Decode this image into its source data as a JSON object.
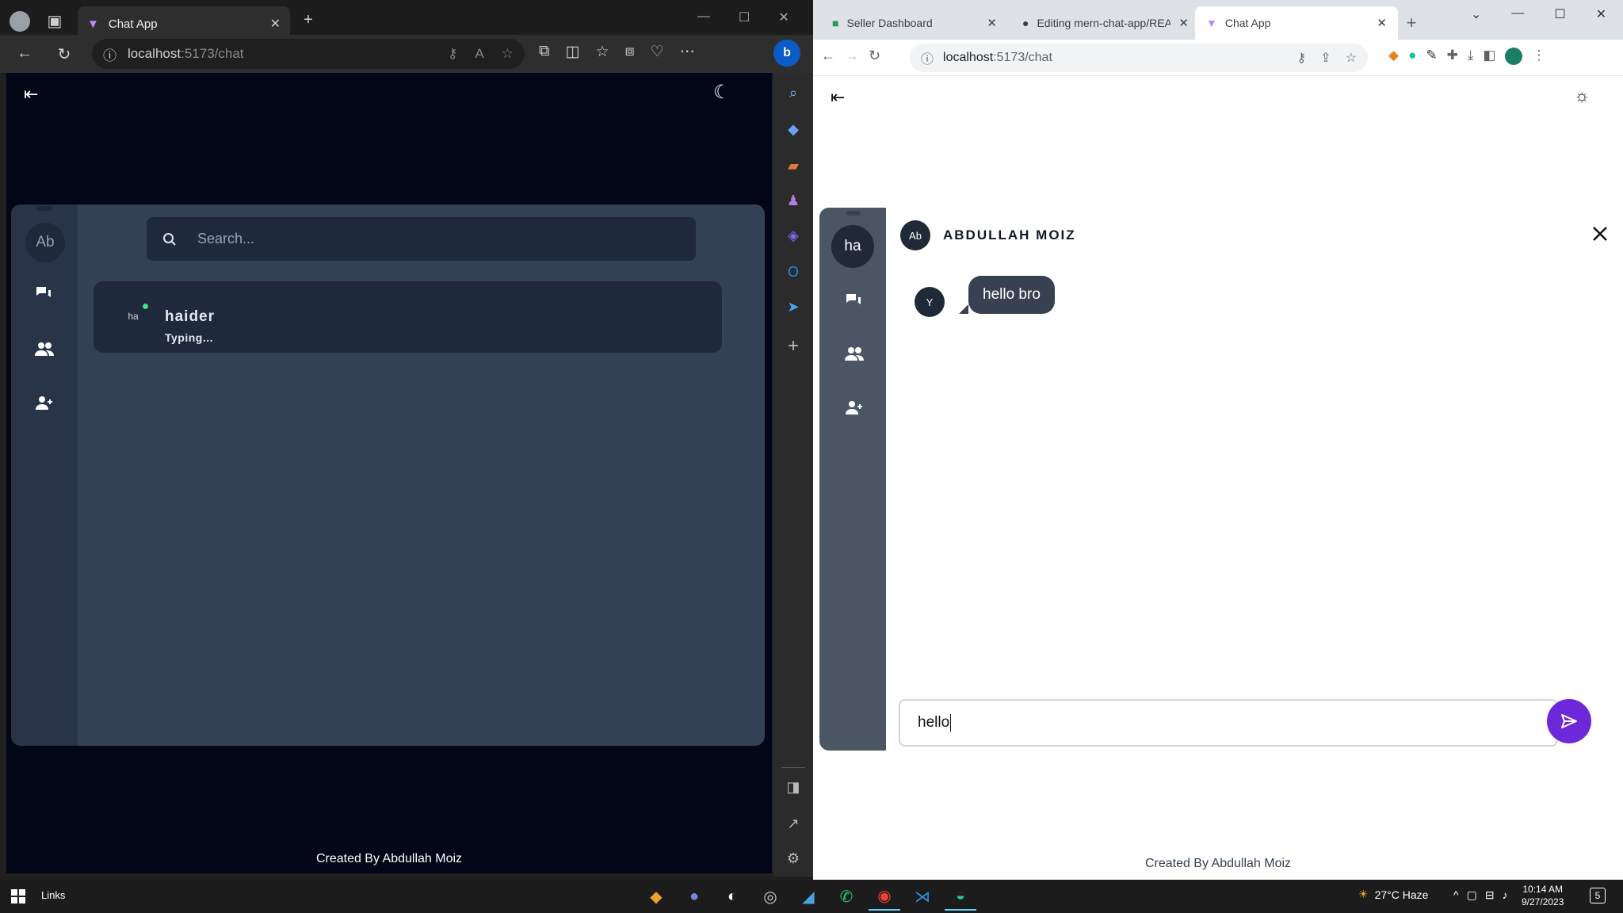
{
  "left_window": {
    "tab_title": "Chat App",
    "url_host": "localhost",
    "url_path": ":5173/chat",
    "page": {
      "avatar_initials": "Ab",
      "search_placeholder": "Search...",
      "conversation": {
        "initials": "ha",
        "name": "haider",
        "status": "Typing..."
      },
      "footer": "Created By Abdullah Moiz"
    }
  },
  "right_window": {
    "tabs": [
      {
        "title": "Seller Dashboard"
      },
      {
        "title": "Editing mern-chat-app/READ"
      },
      {
        "title": "Chat App"
      }
    ],
    "url_host": "localhost",
    "url_path": ":5173/chat",
    "page": {
      "avatar_initials": "ha",
      "chat_header": {
        "initials": "Ab",
        "name": "ABDULLAH MOIZ"
      },
      "messages": [
        {
          "sender_initials": "Y",
          "text": "hello bro"
        }
      ],
      "input_value": "hello",
      "footer": "Created By Abdullah Moiz"
    }
  },
  "taskbar": {
    "links_label": "Links",
    "weather": "27°C  Haze",
    "time": "10:14 AM",
    "date": "9/27/2023",
    "notification_count": "5"
  },
  "colors": {
    "dark_bg": "#020617",
    "card": "#334155",
    "accent": "#6d28d9",
    "online": "#4ade80"
  }
}
